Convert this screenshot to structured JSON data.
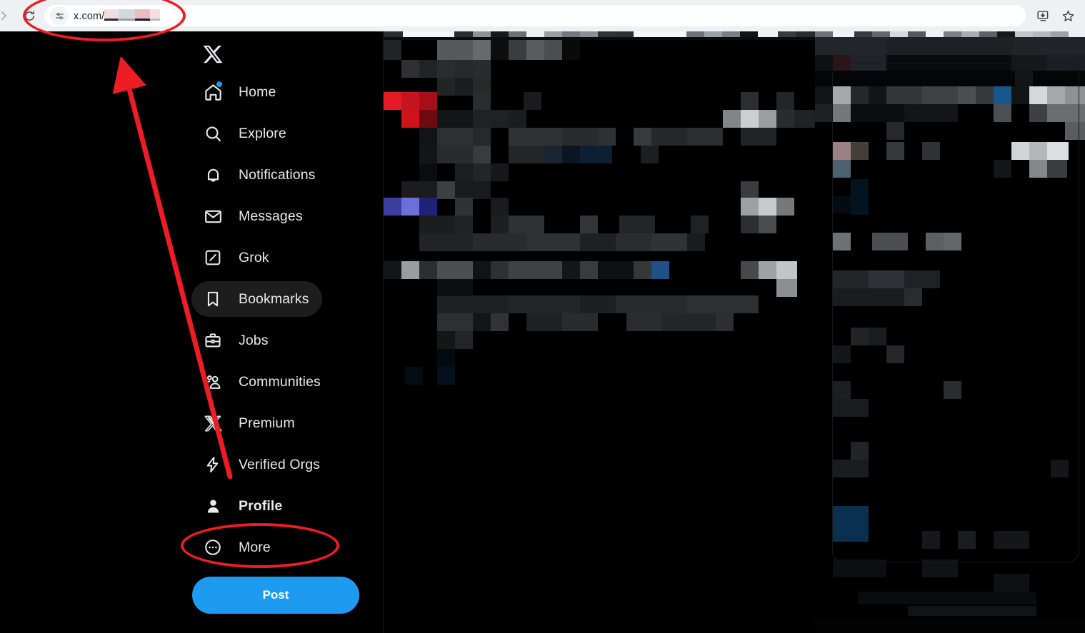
{
  "browser": {
    "back_icon": "back-arrow-icon",
    "forward_icon": "forward-arrow-icon",
    "reload_icon": "reload-icon",
    "site_settings_icon": "site-settings-icon",
    "url_prefix": "x.com/",
    "url_redacted": true,
    "install_icon": "install-app-icon",
    "bookmark_icon": "bookmark-star-icon",
    "omnibox_background": "#ffffff",
    "chrome_background": "#eef0f4"
  },
  "sidebar": {
    "logo": "x-logo",
    "items": [
      {
        "label": "Home",
        "icon": "home-icon",
        "badge": true,
        "active": false,
        "hover": false
      },
      {
        "label": "Explore",
        "icon": "search-icon",
        "badge": false,
        "active": false,
        "hover": false
      },
      {
        "label": "Notifications",
        "icon": "bell-icon",
        "badge": false,
        "active": false,
        "hover": false
      },
      {
        "label": "Messages",
        "icon": "envelope-icon",
        "badge": false,
        "active": false,
        "hover": false
      },
      {
        "label": "Grok",
        "icon": "grok-icon",
        "badge": false,
        "active": false,
        "hover": false
      },
      {
        "label": "Bookmarks",
        "icon": "bookmark-icon",
        "badge": false,
        "active": false,
        "hover": true
      },
      {
        "label": "Jobs",
        "icon": "briefcase-icon",
        "badge": false,
        "active": false,
        "hover": false
      },
      {
        "label": "Communities",
        "icon": "communities-icon",
        "badge": false,
        "active": false,
        "hover": false
      },
      {
        "label": "Premium",
        "icon": "x-premium-icon",
        "badge": false,
        "active": false,
        "hover": false
      },
      {
        "label": "Verified Orgs",
        "icon": "lightning-bolt-icon",
        "badge": false,
        "active": false,
        "hover": false
      },
      {
        "label": "Profile",
        "icon": "person-icon",
        "badge": false,
        "active": true,
        "hover": false
      },
      {
        "label": "More",
        "icon": "more-circle-icon",
        "badge": false,
        "active": false,
        "hover": false
      }
    ],
    "post_button": "Post",
    "post_button_color": "#1d9bf0",
    "hover_pill_color": "#1d1d1d",
    "text_color": "#e7e9ea",
    "badge_color": "#1d9bf0"
  },
  "content": {
    "state": "pixelated-redacted",
    "note": "Timeline and right panel content are mosaic-censored",
    "background": "#000000",
    "divider_color": "#141414"
  },
  "annotations": {
    "color": "#ee1c25",
    "shapes": [
      {
        "type": "ellipse",
        "target": "address-bar"
      },
      {
        "type": "ellipse",
        "target": "sidebar-item-profile"
      },
      {
        "type": "arrow",
        "from": "sidebar-item-profile",
        "to": "address-bar"
      }
    ]
  }
}
